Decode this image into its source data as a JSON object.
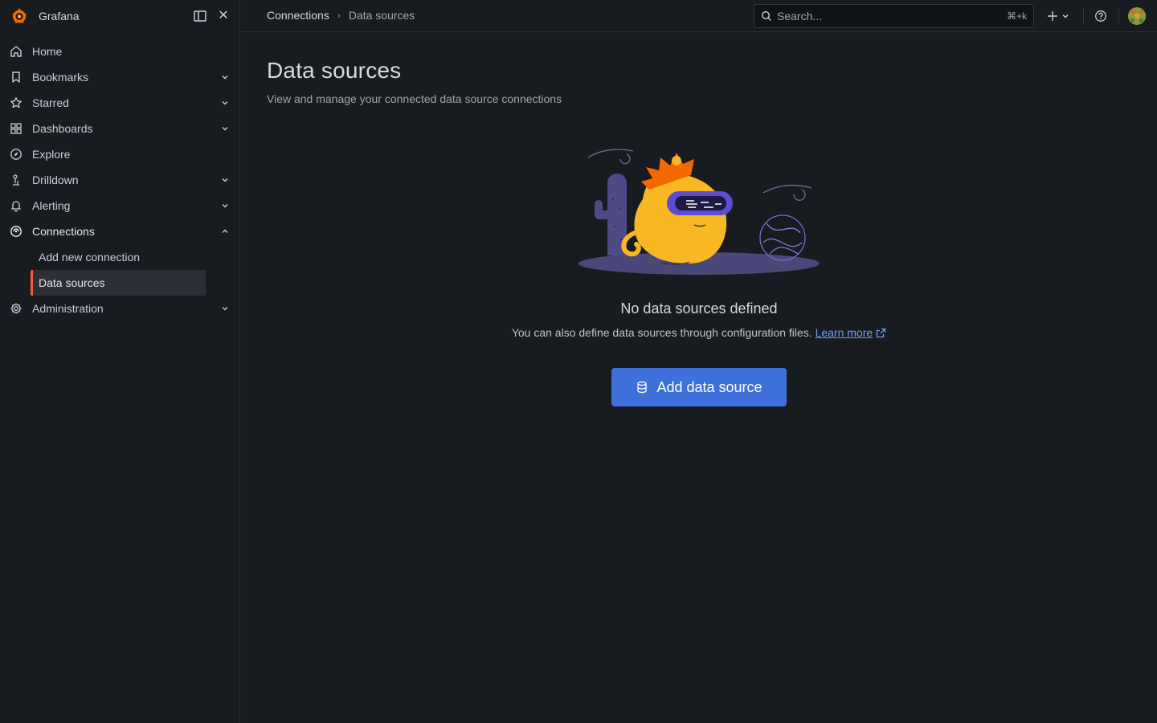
{
  "app": {
    "name": "Grafana"
  },
  "sidebar": {
    "items": [
      {
        "label": "Home",
        "icon": "home-icon",
        "expandable": false
      },
      {
        "label": "Bookmarks",
        "icon": "bookmark-icon",
        "expandable": true
      },
      {
        "label": "Starred",
        "icon": "star-icon",
        "expandable": true
      },
      {
        "label": "Dashboards",
        "icon": "grid-icon",
        "expandable": true
      },
      {
        "label": "Explore",
        "icon": "compass-icon",
        "expandable": false
      },
      {
        "label": "Drilldown",
        "icon": "drilldown-icon",
        "expandable": true
      },
      {
        "label": "Alerting",
        "icon": "bell-icon",
        "expandable": true
      },
      {
        "label": "Connections",
        "icon": "connections-icon",
        "expandable": true,
        "expanded": true
      },
      {
        "label": "Administration",
        "icon": "gear-icon",
        "expandable": true
      }
    ],
    "connections_children": [
      {
        "label": "Add new connection"
      },
      {
        "label": "Data sources",
        "selected": true
      }
    ]
  },
  "topbar": {
    "breadcrumb": [
      "Connections",
      "Data sources"
    ],
    "search_placeholder": "Search...",
    "search_shortcut": "⌘+k"
  },
  "main": {
    "title": "Data sources",
    "subtitle": "View and manage your connected data source connections",
    "empty_title": "No data sources defined",
    "empty_desc": "You can also define data sources through configuration files.",
    "learn_more": "Learn more",
    "add_button": "Add data source"
  },
  "colors": {
    "background": "#181b1f",
    "accent_orange": "#f55f3e",
    "primary_button": "#3d71d9",
    "link": "#6e9fff"
  }
}
